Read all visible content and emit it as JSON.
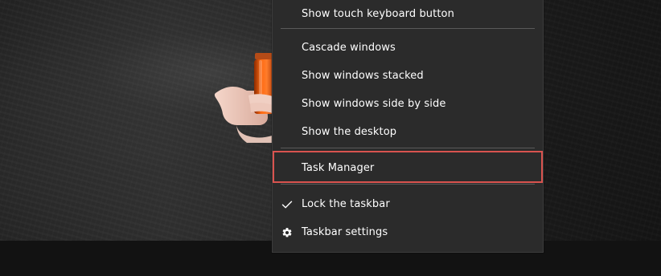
{
  "colors": {
    "menu_background": "#2b2b2b",
    "menu_text": "#ffffff",
    "separator": "#5a5a5a",
    "highlight": "#d9534f",
    "taskbar": "#121212"
  },
  "context_menu": {
    "items": {
      "show_touch_keyboard_button": {
        "label": "Show touch keyboard button"
      },
      "cascade_windows": {
        "label": "Cascade windows"
      },
      "show_windows_stacked": {
        "label": "Show windows stacked"
      },
      "show_windows_side_by_side": {
        "label": "Show windows side by side"
      },
      "show_the_desktop": {
        "label": "Show the desktop"
      },
      "task_manager": {
        "label": "Task Manager",
        "highlighted": true
      },
      "lock_the_taskbar": {
        "label": "Lock the taskbar",
        "checked": true,
        "icon": "check-icon"
      },
      "taskbar_settings": {
        "label": "Taskbar settings",
        "icon": "gear-icon"
      }
    }
  }
}
